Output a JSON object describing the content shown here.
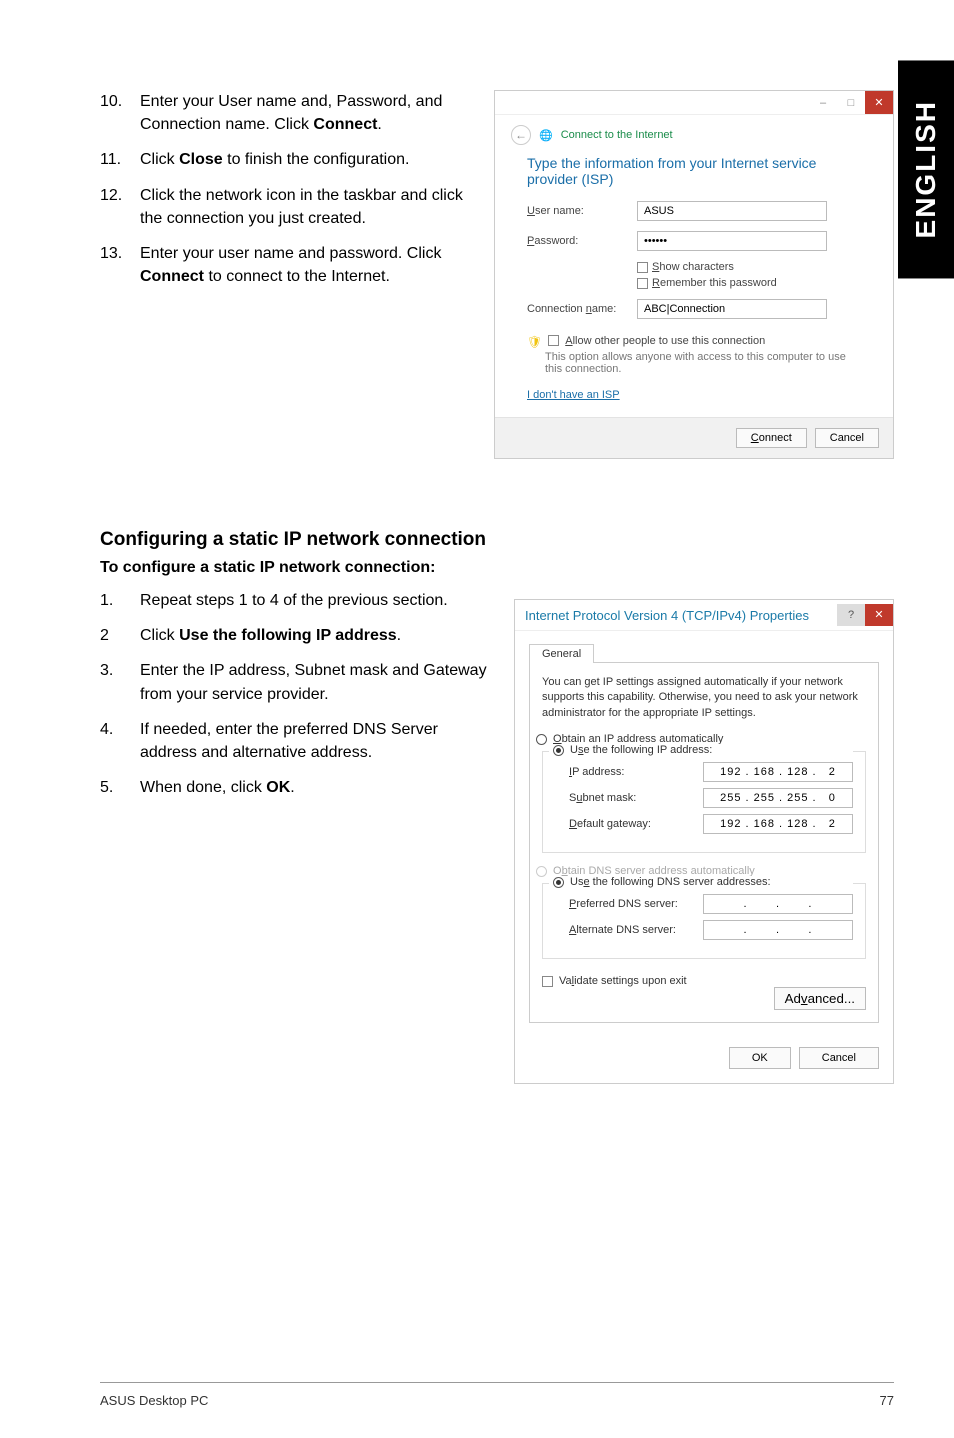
{
  "lang_tab": "ENGLISH",
  "top_steps": [
    {
      "num": "10.",
      "pre": "Enter your User name and, Password, and Connection name. Click ",
      "bold": "Connect",
      "post": "."
    },
    {
      "num": "11.",
      "pre": "Click ",
      "bold": "Close",
      "post": " to finish the configuration."
    },
    {
      "num": "12.",
      "pre": "Click the network icon in the taskbar and click the connection you just created.",
      "bold": "",
      "post": ""
    },
    {
      "num": "13.",
      "pre": "Enter your user name and password. Click ",
      "bold": "Connect",
      "post": " to connect to the Internet."
    }
  ],
  "dialog1": {
    "crumb": "Connect to the Internet",
    "heading": "Type the information from your Internet service provider (ISP)",
    "labels": {
      "user": "User name:",
      "pass": "Password:",
      "conn": "Connection name:"
    },
    "values": {
      "user": "ASUS",
      "pass": "••••••",
      "conn": "ABC|Connection"
    },
    "checks": {
      "show": "Show characters",
      "remember": "Remember this password"
    },
    "allow_label": "Allow other people to use this connection",
    "allow_sub": "This option allows anyone with access to this computer to use this connection.",
    "no_isp": "I don't have an ISP",
    "btn_connect": "Connect",
    "btn_cancel": "Cancel"
  },
  "section_heading": "Configuring a static IP network connection",
  "section_sub": "To configure a static IP network connection:",
  "mid_steps": [
    {
      "num": "1.",
      "pre": "Repeat steps 1 to 4 of the previous section.",
      "bold": "",
      "post": ""
    },
    {
      "num": "2",
      "pre": "Click ",
      "bold": "Use the following IP address",
      "post": "."
    },
    {
      "num": "3.",
      "pre": "Enter the IP address, Subnet mask and Gateway from your service provider.",
      "bold": "",
      "post": ""
    },
    {
      "num": "4.",
      "pre": "If needed, enter the preferred DNS Server address and alternative address.",
      "bold": "",
      "post": ""
    },
    {
      "num": "5.",
      "pre": "When done, click ",
      "bold": "OK",
      "post": "."
    }
  ],
  "dialog2": {
    "title": "Internet Protocol Version 4 (TCP/IPv4) Properties",
    "tab": "General",
    "desc": "You can get IP settings assigned automatically if your network supports this capability. Otherwise, you need to ask your network administrator for the appropriate IP settings.",
    "radio_auto_ip": "Obtain an IP address automatically",
    "radio_use_ip": "Use the following IP address:",
    "ip_label": "IP address:",
    "ip_value": "192 . 168 . 128 .   2",
    "subnet_label": "Subnet mask:",
    "subnet_value": "255 . 255 . 255 .   0",
    "gateway_label": "Default gateway:",
    "gateway_value": "192 . 168 . 128 .   2",
    "radio_auto_dns": "Obtain DNS server address automatically",
    "radio_use_dns": "Use the following DNS server addresses:",
    "pref_dns_label": "Preferred DNS server:",
    "pref_dns_value": ".       .       .",
    "alt_dns_label": "Alternate DNS server:",
    "alt_dns_value": ".       .       .",
    "validate": "Validate settings upon exit",
    "advanced": "Advanced...",
    "ok": "OK",
    "cancel": "Cancel"
  },
  "footer_left": "ASUS Desktop PC",
  "footer_right": "77",
  "chart_data": {
    "type": "table",
    "description": "IPv4 properties dialog field values as depicted",
    "rows": [
      {
        "field": "IP address",
        "value": "192.168.128.2"
      },
      {
        "field": "Subnet mask",
        "value": "255.255.255.0"
      },
      {
        "field": "Default gateway",
        "value": "192.168.128.2"
      },
      {
        "field": "Preferred DNS server",
        "value": ""
      },
      {
        "field": "Alternate DNS server",
        "value": ""
      }
    ]
  }
}
